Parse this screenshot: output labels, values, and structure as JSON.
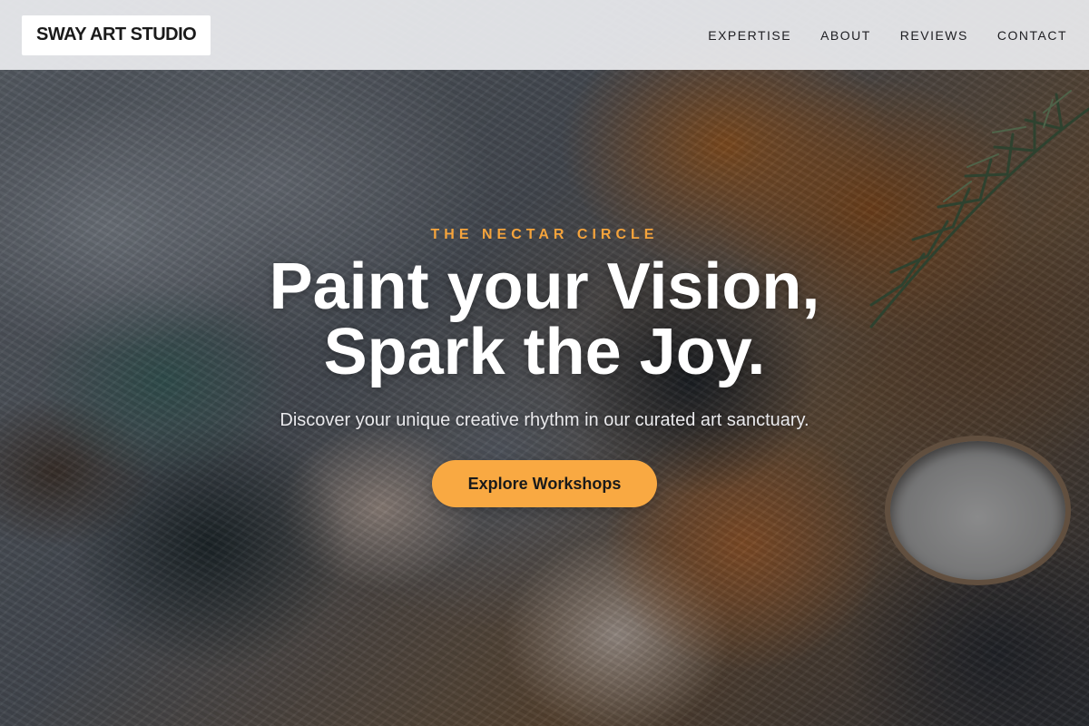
{
  "brand": {
    "name": "SWAY ART STUDIO"
  },
  "nav": {
    "items": [
      {
        "label": "EXPERTISE"
      },
      {
        "label": "ABOUT"
      },
      {
        "label": "REVIEWS"
      },
      {
        "label": "CONTACT"
      }
    ]
  },
  "hero": {
    "eyebrow": "THE NECTAR CIRCLE",
    "headline_line1": "Paint your Vision,",
    "headline_line2": "Spark the Joy.",
    "subheadline": "Discover your unique creative rhythm in our curated art sanctuary.",
    "cta_label": "Explore Workshops"
  },
  "colors": {
    "accent": "#f9a942",
    "eyebrow": "#f5a43c",
    "nav_background": "#ebecef",
    "headline": "#ffffff"
  }
}
